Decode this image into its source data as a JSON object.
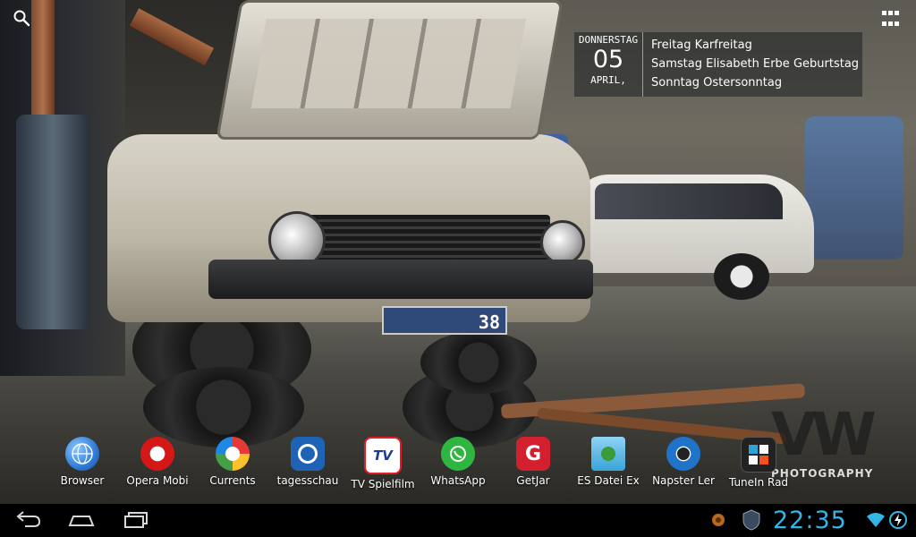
{
  "top": {
    "search_icon": "search-icon",
    "apps_icon": "all-apps-icon"
  },
  "calendar": {
    "weekday": "DONNERSTAG",
    "day": "05",
    "month": "APRIL,",
    "events": [
      "Freitag Karfreitag",
      "Samstag Elisabeth Erbe Geburtstag",
      "Sonntag Ostersonntag"
    ]
  },
  "wallpaper": {
    "plate_text": "38",
    "watermark_big": "VW",
    "watermark_small": "PHOTOGRAPHY"
  },
  "dock": [
    {
      "label": "Browser",
      "icon": "browser-globe-icon",
      "color": "#2e7bd6"
    },
    {
      "label": "Opera Mobi",
      "icon": "opera-icon",
      "color": "#d41818"
    },
    {
      "label": "Currents",
      "icon": "currents-icon",
      "color": "#f0b400"
    },
    {
      "label": "tagesschau",
      "icon": "tagesschau-icon",
      "color": "#1e63b5"
    },
    {
      "label": "TV Spielfilm",
      "icon": "tv-spielfilm-icon",
      "color": "#e51c23"
    },
    {
      "label": "WhatsApp",
      "icon": "whatsapp-icon",
      "color": "#2fb640"
    },
    {
      "label": "GetJar",
      "icon": "getjar-icon",
      "color": "#d3202f"
    },
    {
      "label": "ES Datei Ex",
      "icon": "es-file-explorer-icon",
      "color": "#3aa3d8"
    },
    {
      "label": "Napster Ler",
      "icon": "napster-icon",
      "color": "#1f74c9"
    },
    {
      "label": "TuneIn Rad",
      "icon": "tunein-icon",
      "color": "#222222"
    }
  ],
  "navbar": {
    "back_icon": "back-icon",
    "home_icon": "home-icon",
    "recents_icon": "recent-apps-icon",
    "time": "22:35",
    "accent": "#33b5e5"
  }
}
